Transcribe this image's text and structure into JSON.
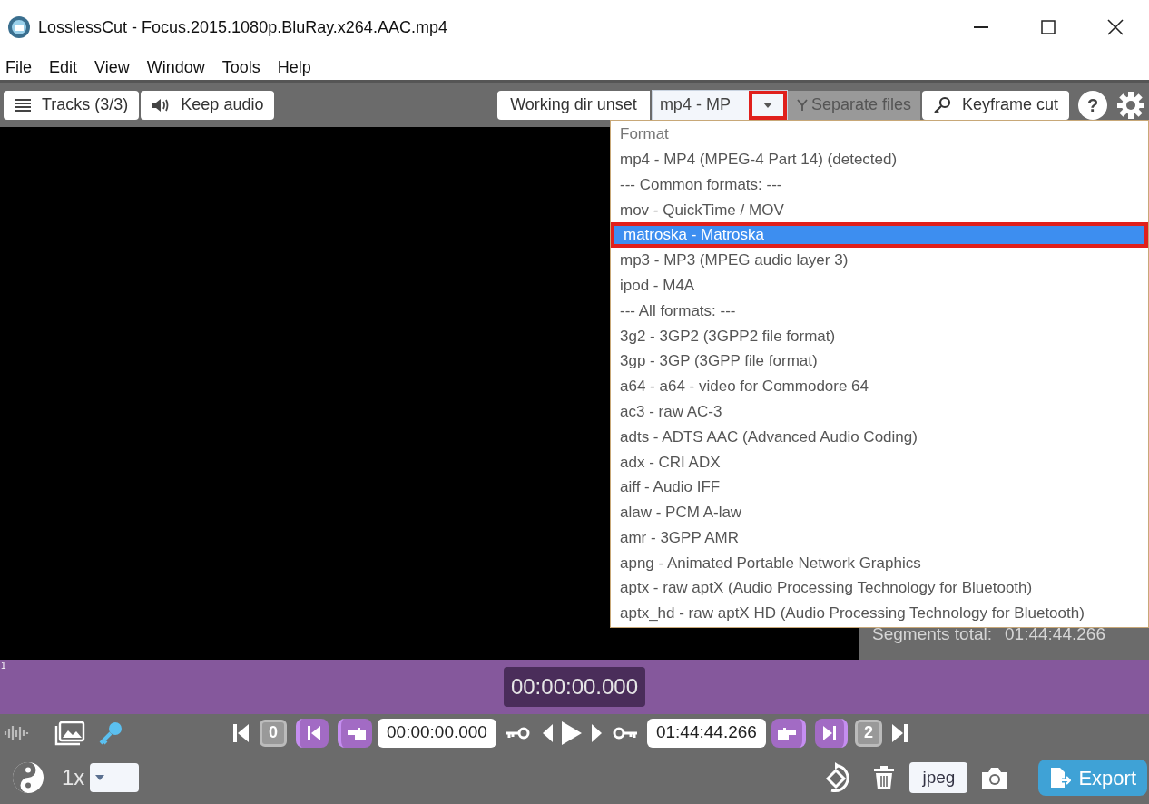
{
  "window": {
    "title": "LosslessCut - Focus.2015.1080p.BluRay.x264.AAC.mp4"
  },
  "menu": [
    "File",
    "Edit",
    "View",
    "Window",
    "Tools",
    "Help"
  ],
  "toolbar": {
    "tracks": "Tracks (3/3)",
    "audio": "Keep audio",
    "working_dir": "Working dir unset",
    "format_value": "mp4 - MP",
    "separate": "Separate files",
    "cut_mode": "Keyframe cut",
    "help": "?"
  },
  "format_menu": [
    {
      "kind": "header",
      "label": "Format"
    },
    {
      "kind": "option",
      "label": "mp4 - MP4 (MPEG-4 Part 14) (detected)",
      "selected": false
    },
    {
      "kind": "option",
      "label": "--- Common formats: ---",
      "selected": false
    },
    {
      "kind": "option",
      "label": "mov - QuickTime / MOV",
      "selected": false
    },
    {
      "kind": "option",
      "label": "matroska - Matroska",
      "selected": true
    },
    {
      "kind": "option",
      "label": "mp3 - MP3 (MPEG audio layer 3)",
      "selected": false
    },
    {
      "kind": "option",
      "label": "ipod - M4A",
      "selected": false
    },
    {
      "kind": "option",
      "label": "--- All formats: ---",
      "selected": false
    },
    {
      "kind": "option",
      "label": "3g2 - 3GP2 (3GPP2 file format)",
      "selected": false
    },
    {
      "kind": "option",
      "label": "3gp - 3GP (3GPP file format)",
      "selected": false
    },
    {
      "kind": "option",
      "label": "a64 - a64 - video for Commodore 64",
      "selected": false
    },
    {
      "kind": "option",
      "label": "ac3 - raw AC-3",
      "selected": false
    },
    {
      "kind": "option",
      "label": "adts - ADTS AAC (Advanced Audio Coding)",
      "selected": false
    },
    {
      "kind": "option",
      "label": "adx - CRI ADX",
      "selected": false
    },
    {
      "kind": "option",
      "label": "aiff - Audio IFF",
      "selected": false
    },
    {
      "kind": "option",
      "label": "alaw - PCM A-law",
      "selected": false
    },
    {
      "kind": "option",
      "label": "amr - 3GPP AMR",
      "selected": false
    },
    {
      "kind": "option",
      "label": "apng - Animated Portable Network Graphics",
      "selected": false
    },
    {
      "kind": "option",
      "label": "aptx - raw aptX (Audio Processing Technology for Bluetooth)",
      "selected": false
    },
    {
      "kind": "option",
      "label": "aptx_hd - raw aptX HD (Audio Processing Technology for Bluetooth)",
      "selected": false
    }
  ],
  "segments_total": {
    "label": "Segments total:",
    "value": "01:44:44.266"
  },
  "timeline": {
    "segment_number": "1",
    "current_time": "00:00:00.000"
  },
  "controls": {
    "start_segment": "0",
    "start_time": "00:00:00.000",
    "end_time": "01:44:44.266",
    "end_segment": "2",
    "speed": "1x",
    "capture_format": "jpeg",
    "export": "Export"
  }
}
